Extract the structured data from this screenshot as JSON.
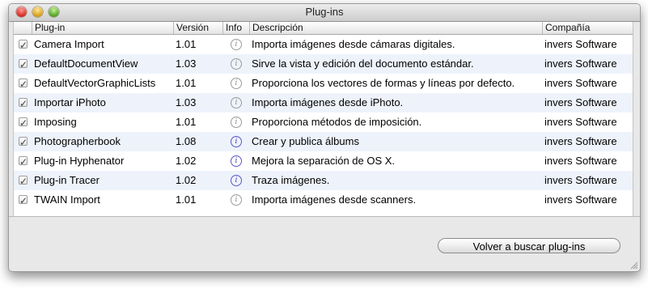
{
  "window": {
    "title": "Plug-ins"
  },
  "table": {
    "columns": [
      "Plug-in",
      "Versión",
      "Info",
      "Descripción",
      "Compañía"
    ],
    "rows": [
      {
        "enabled": true,
        "name": "Camera Import",
        "version": "1.01",
        "info_active": false,
        "description": "Importa imágenes desde cámaras digitales.",
        "company": "invers Software"
      },
      {
        "enabled": true,
        "name": "DefaultDocumentView",
        "version": "1.03",
        "info_active": false,
        "description": "Sirve la vista y edición del documento estándar.",
        "company": "invers Software"
      },
      {
        "enabled": true,
        "name": "DefaultVectorGraphicLists",
        "version": "1.01",
        "info_active": false,
        "description": "Proporciona los vectores de formas y líneas por defecto.",
        "company": "invers Software"
      },
      {
        "enabled": true,
        "name": "Importar iPhoto",
        "version": "1.03",
        "info_active": false,
        "description": "Importa imágenes desde iPhoto.",
        "company": "invers Software"
      },
      {
        "enabled": true,
        "name": "Imposing",
        "version": "1.01",
        "info_active": false,
        "description": "Proporciona métodos de imposición.",
        "company": "invers Software"
      },
      {
        "enabled": true,
        "name": "Photographerbook",
        "version": "1.08",
        "info_active": true,
        "description": "Crear y publica álbums",
        "company": "invers Software"
      },
      {
        "enabled": true,
        "name": "Plug-in Hyphenator",
        "version": "1.02",
        "info_active": true,
        "description": "Mejora la separación de OS X.",
        "company": "invers Software"
      },
      {
        "enabled": true,
        "name": "Plug-in Tracer",
        "version": "1.02",
        "info_active": true,
        "description": "Traza imágenes.",
        "company": "invers Software"
      },
      {
        "enabled": true,
        "name": "TWAIN Import",
        "version": "1.01",
        "info_active": false,
        "description": "Importa imágenes desde scanners.",
        "company": "invers Software"
      }
    ]
  },
  "buttons": {
    "rescan": "Volver a buscar plug-ins"
  },
  "icons": {
    "info": "info-icon",
    "checkbox": "checkmark-icon",
    "resize": "resize-grip-icon"
  }
}
